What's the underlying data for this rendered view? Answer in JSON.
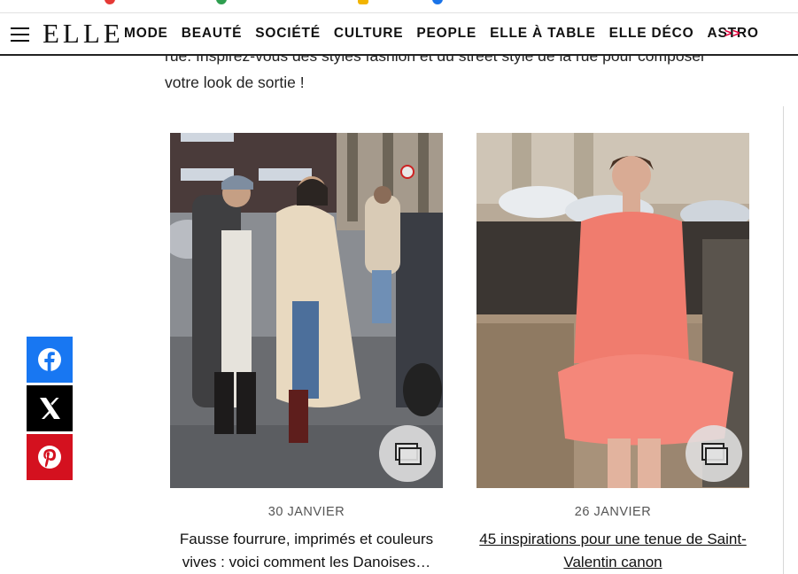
{
  "header": {
    "logo": "ELLE",
    "nav": [
      "MODE",
      "BEAUTÉ",
      "SOCIÉTÉ",
      "CULTURE",
      "PEOPLE",
      "ELLE À TABLE",
      "ELLE DÉCO",
      "ASTRO"
    ],
    "more": ">>"
  },
  "intro": {
    "line1": "rue. Inspirez-vous des styles fashion et du street style de la rue pour composer",
    "line2": "votre look de sortie !"
  },
  "cards": [
    {
      "date": "30 JANVIER",
      "title": "Fausse fourrure, imprimés et couleurs vives : voici comment les Danoises…"
    },
    {
      "date": "26 JANVIER",
      "title": "45 inspirations pour une tenue de Saint-Valentin canon"
    }
  ],
  "share": {
    "facebook_color": "#1877f2",
    "x_color": "#000000",
    "pinterest_color": "#d4111f"
  }
}
